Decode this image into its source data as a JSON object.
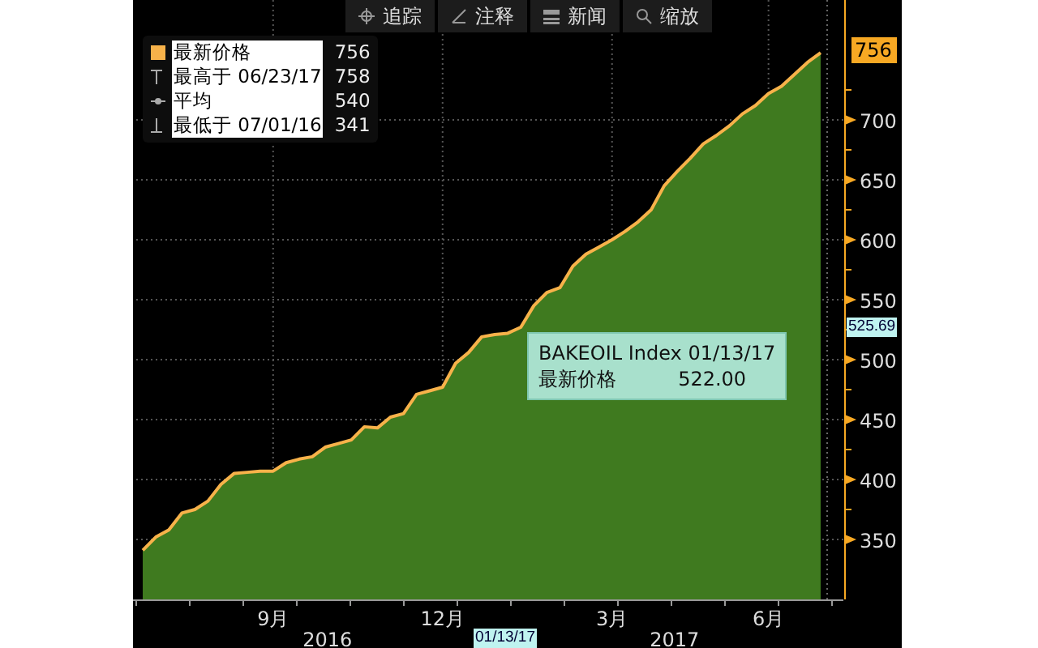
{
  "toolbar": [
    {
      "kind": "track",
      "label": "追踪"
    },
    {
      "kind": "annotate",
      "label": "注释"
    },
    {
      "kind": "news",
      "label": "新闻"
    },
    {
      "kind": "zoom",
      "label": "缩放"
    }
  ],
  "legend": [
    {
      "kind": "last",
      "label": "最新价格",
      "value": "756"
    },
    {
      "kind": "high",
      "label": "最高于 06/23/17",
      "value": "758"
    },
    {
      "kind": "average",
      "label": "平均",
      "value": "540"
    },
    {
      "kind": "low",
      "label": "最低于 07/01/16",
      "value": "341"
    }
  ],
  "price_tag": "756",
  "crosshair": {
    "level_tag": "525.69",
    "date_tag": "01/13/17"
  },
  "tooltip": {
    "title": "BAKEOIL Index 01/13/17",
    "label": "最新价格",
    "value": "522.00"
  },
  "years": [
    "2016",
    "2017"
  ],
  "chart_data": {
    "type": "area",
    "categories": [
      null,
      null,
      null,
      null,
      null,
      null,
      null,
      null,
      null,
      null,
      "9月",
      null,
      null,
      null,
      null,
      null,
      null,
      null,
      null,
      null,
      null,
      null,
      null,
      "12月",
      null,
      null,
      null,
      null,
      null,
      null,
      null,
      null,
      null,
      null,
      null,
      null,
      "3月",
      null,
      null,
      null,
      null,
      null,
      null,
      null,
      null,
      null,
      null,
      null,
      "6月",
      null,
      null,
      null,
      null
    ],
    "grid": true,
    "series": [
      {
        "color": "#3f7a1f",
        "values": [
          341,
          352,
          358,
          372,
          375,
          382,
          396,
          405,
          406,
          407,
          407,
          414,
          417,
          419,
          427,
          430,
          433,
          444,
          443,
          452,
          455,
          471,
          474,
          477,
          497,
          506,
          519,
          521,
          522,
          527,
          545,
          556,
          560,
          578,
          588,
          594,
          600,
          607,
          615,
          625,
          645,
          657,
          668,
          680,
          687,
          695,
          705,
          712,
          722,
          728,
          738,
          748,
          756
        ]
      }
    ],
    "ylim": [
      300,
      800
    ],
    "yticks": [
      350,
      400,
      450,
      500,
      550,
      600,
      650,
      700
    ]
  }
}
